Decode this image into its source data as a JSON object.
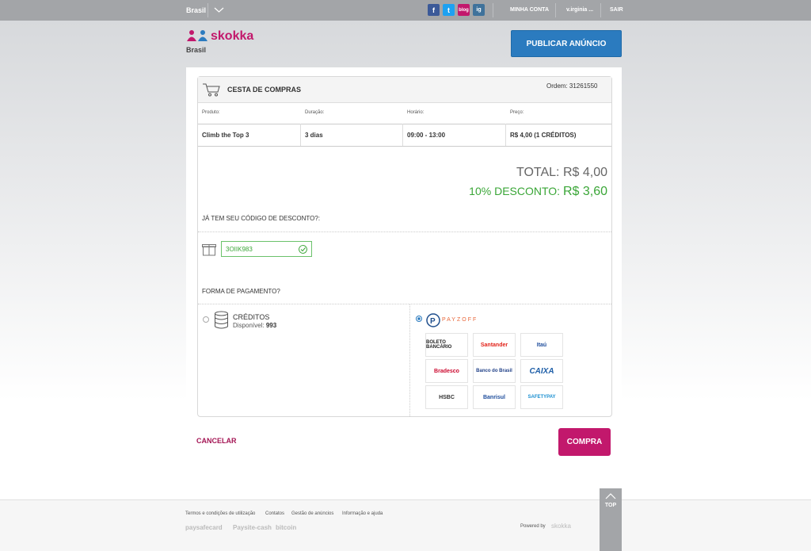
{
  "topbar": {
    "country": "Brasil",
    "social": {
      "facebook": "f",
      "twitter": "t",
      "blog": "blog",
      "instagram": "ig"
    },
    "account_link": "MINHA CONTA",
    "user_link": "v.irginia ...",
    "logout_link": "SAIR"
  },
  "header": {
    "logo_text": "skokka",
    "logo_sub": "Brasil",
    "publish_button": "PUBLICAR ANÚNCIO"
  },
  "cart": {
    "title": "CESTA DE COMPRAS",
    "order": "Ordem: 31261550",
    "columns": [
      "Produto:",
      "Duração:",
      "Horário:",
      "Preço:"
    ],
    "row": [
      "Climb the Top 3",
      "3 dias",
      "09:00 - 13:00",
      "R$ 4,00 (1 CRÉDITOS)"
    ],
    "total_label": "TOTAL:",
    "total_value": "R$ 4,00",
    "discount_label": "10% DESCONTO:",
    "discount_value": "R$ 3,60"
  },
  "discount": {
    "question": "JÁ TEM SEU CÓDIGO DE DESCONTO?:",
    "code_value": "3OIIK983"
  },
  "payment": {
    "question": "FORMA DE PAGAMENTO?",
    "credits_label": "CRÉDITOS",
    "available_label": "Disponível:",
    "available_value": "993",
    "provider": "PAYZOFF",
    "banks": [
      "BOLETO BANCÁRIO",
      "Santander",
      "Itaú",
      "Bradesco",
      "Banco do Brasil",
      "CAIXA",
      "HSBC",
      "Banrisul",
      "SAFETYPAY"
    ]
  },
  "actions": {
    "cancel": "CANCELAR",
    "buy": "COMPRA"
  },
  "footer": {
    "links": [
      "Termos e condições de utilização",
      "Contatos",
      "Gestão de anúncios",
      "Informação e ajuda"
    ],
    "payments": [
      "paysafecard",
      "Paysite-cash",
      "bitcoin"
    ],
    "powered_by": "Powered by",
    "powered_brand": "skokka",
    "top_label": "TOP"
  },
  "colors": {
    "brand": "#c2186c",
    "primary": "#2b7bbf",
    "success": "#3aa637",
    "topbar": "#a3a5a8"
  }
}
